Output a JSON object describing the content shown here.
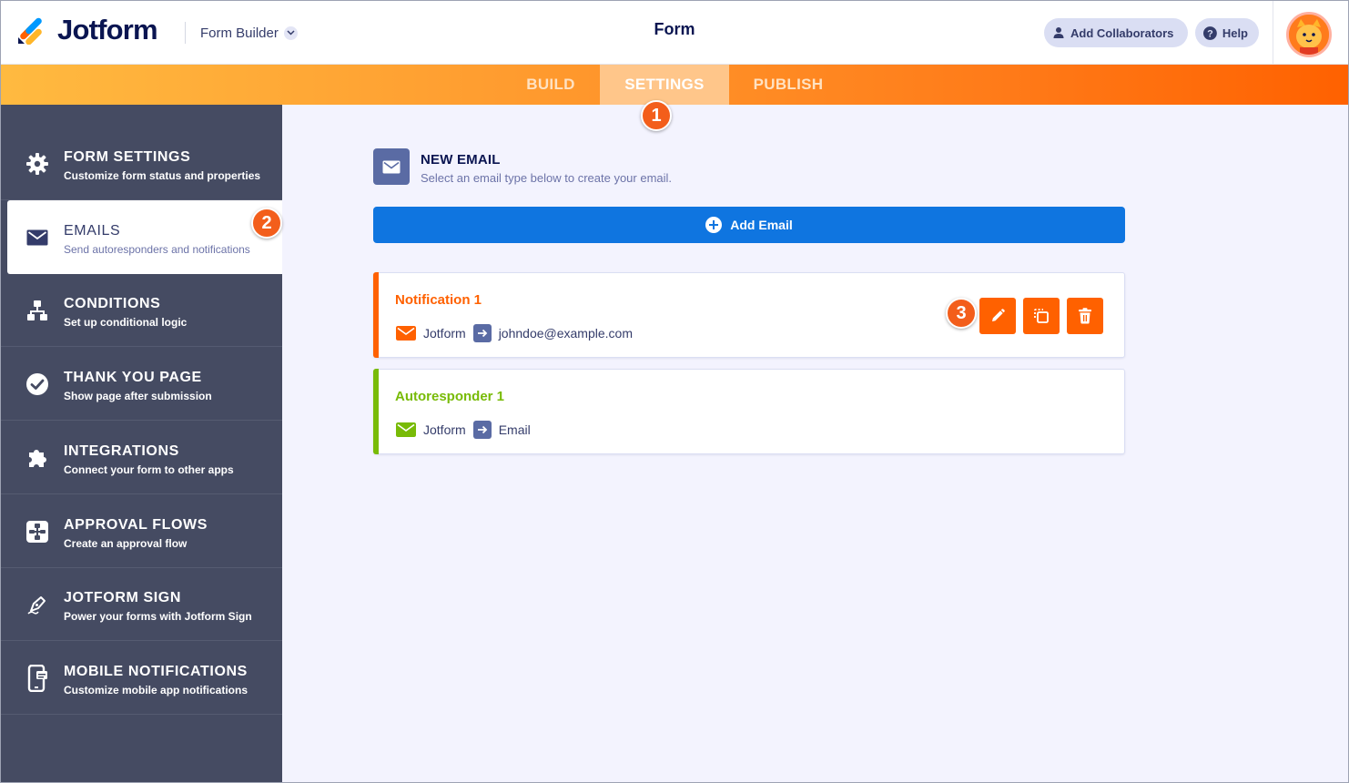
{
  "header": {
    "brand": "Jotform",
    "builder_label": "Form Builder",
    "form_title": "Form",
    "collaborators_label": "Add Collaborators",
    "help_label": "Help"
  },
  "tabs": [
    {
      "label": "BUILD",
      "active": false
    },
    {
      "label": "SETTINGS",
      "active": true
    },
    {
      "label": "PUBLISH",
      "active": false
    }
  ],
  "steps": [
    "1",
    "2",
    "3"
  ],
  "sidebar": {
    "items": [
      {
        "title": "FORM SETTINGS",
        "subtitle": "Customize form status and properties",
        "icon": "gear-icon",
        "active": false
      },
      {
        "title": "EMAILS",
        "subtitle": "Send autoresponders and notifications",
        "icon": "envelope-icon",
        "active": true
      },
      {
        "title": "CONDITIONS",
        "subtitle": "Set up conditional logic",
        "icon": "conditions-icon",
        "active": false
      },
      {
        "title": "THANK YOU PAGE",
        "subtitle": "Show page after submission",
        "icon": "check-circle-icon",
        "active": false
      },
      {
        "title": "INTEGRATIONS",
        "subtitle": "Connect your form to other apps",
        "icon": "puzzle-icon",
        "active": false
      },
      {
        "title": "APPROVAL FLOWS",
        "subtitle": "Create an approval flow",
        "icon": "approval-flow-icon",
        "active": false
      },
      {
        "title": "JOTFORM SIGN",
        "subtitle": "Power your forms with Jotform Sign",
        "icon": "pen-nib-icon",
        "active": false
      },
      {
        "title": "MOBILE NOTIFICATIONS",
        "subtitle": "Customize mobile app notifications",
        "icon": "mobile-icon",
        "active": false
      }
    ]
  },
  "main": {
    "new_email_title": "NEW EMAIL",
    "new_email_subtitle": "Select an email type below to create your email.",
    "add_email_label": "Add Email",
    "emails": [
      {
        "name": "Notification 1",
        "from": "Jotform",
        "to": "johndoe@example.com",
        "color": "#ff6100"
      },
      {
        "name": "Autoresponder 1",
        "from": "Jotform",
        "to": "Email",
        "color": "#78bb07"
      }
    ]
  },
  "colors": {
    "accent_orange": "#ff6100",
    "sidebar_bg": "#454b62",
    "primary_blue": "#0f75e0",
    "autoresponder_green": "#78bb07"
  }
}
